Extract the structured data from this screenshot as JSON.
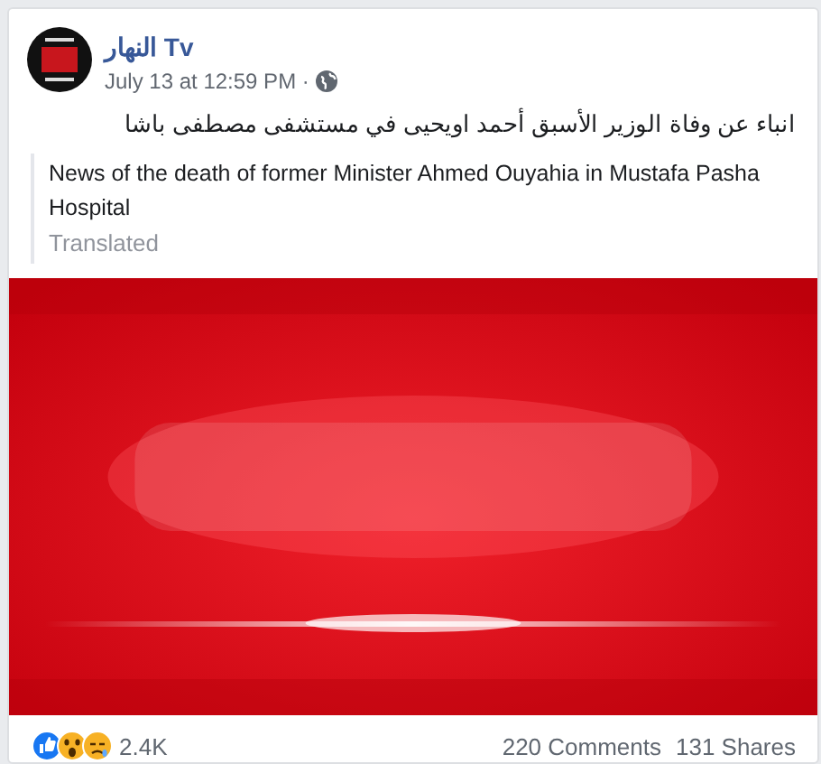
{
  "post": {
    "author": "النهار Tv",
    "timestamp": "July 13 at 12:59 PM · ",
    "text": "انباء عن وفاة الوزير الأسبق أحمد اويحيى في مستشفى مصطفى باشا",
    "translation": {
      "text": "News of the death of former Minister Ahmed Ouyahia in Mustafa Pasha Hospital",
      "note": "Translated"
    },
    "reactions": {
      "count": "2.4K"
    },
    "comments": "220 Comments",
    "shares": "131 Shares"
  }
}
